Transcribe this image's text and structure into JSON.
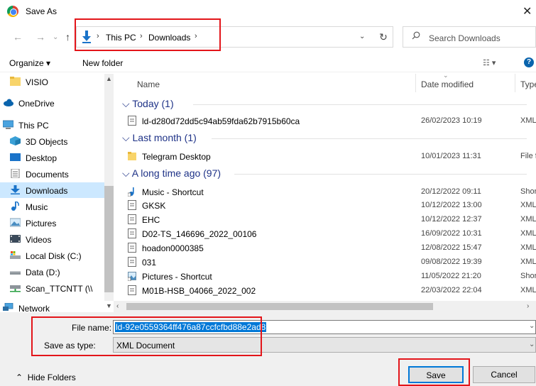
{
  "window": {
    "title": "Save As",
    "close": "✕"
  },
  "address": {
    "crumbs": [
      "This PC",
      "Downloads"
    ],
    "separator": "›",
    "search_placeholder": "Search Downloads"
  },
  "toolbar": {
    "organize": "Organize ▾",
    "new_folder": "New folder",
    "help": "?"
  },
  "nav": {
    "items": [
      {
        "label": "VISIO",
        "icon": "folder-icon"
      },
      {
        "label": "OneDrive",
        "icon": "cloud-icon"
      },
      {
        "label": "This PC",
        "icon": "computer-icon"
      },
      {
        "label": "3D Objects",
        "icon": "cube-icon"
      },
      {
        "label": "Desktop",
        "icon": "desktop-icon"
      },
      {
        "label": "Documents",
        "icon": "documents-icon"
      },
      {
        "label": "Downloads",
        "icon": "download-icon",
        "selected": true
      },
      {
        "label": "Music",
        "icon": "music-icon"
      },
      {
        "label": "Pictures",
        "icon": "pictures-icon"
      },
      {
        "label": "Videos",
        "icon": "videos-icon"
      },
      {
        "label": "Local Disk (C:)",
        "icon": "disk-icon"
      },
      {
        "label": "Data (D:)",
        "icon": "drive-icon"
      },
      {
        "label": "Scan_TTCNTT (\\\\",
        "icon": "network-drive-icon"
      },
      {
        "label": "Network",
        "icon": "network-icon"
      }
    ]
  },
  "columns": {
    "name": "Name",
    "date": "Date modified",
    "type": "Type"
  },
  "groups": [
    {
      "header": "Today (1)",
      "rows": [
        {
          "name": "ld-d280d72dd5c94ab59fda62b7915b60ca",
          "date": "26/02/2023 10:19",
          "type": "XML",
          "icon": "file-icon"
        }
      ]
    },
    {
      "header": "Last month (1)",
      "rows": [
        {
          "name": "Telegram Desktop",
          "date": "10/01/2023 11:31",
          "type": "File f",
          "icon": "folder-icon"
        }
      ]
    },
    {
      "header": "A long time ago (97)",
      "rows": [
        {
          "name": "Music - Shortcut",
          "date": "20/12/2022 09:11",
          "type": "Shor",
          "icon": "music-shortcut-icon"
        },
        {
          "name": "GKSK",
          "date": "10/12/2022 13:00",
          "type": "XML",
          "icon": "file-icon"
        },
        {
          "name": "EHC",
          "date": "10/12/2022 12:37",
          "type": "XML",
          "icon": "file-icon"
        },
        {
          "name": "D02-TS_146696_2022_00106",
          "date": "16/09/2022 10:31",
          "type": "XML",
          "icon": "file-icon"
        },
        {
          "name": "hoadon0000385",
          "date": "12/08/2022 15:47",
          "type": "XML",
          "icon": "file-icon"
        },
        {
          "name": "031",
          "date": "09/08/2022 19:39",
          "type": "XML",
          "icon": "file-icon"
        },
        {
          "name": "Pictures - Shortcut",
          "date": "11/05/2022 21:20",
          "type": "Shor",
          "icon": "pictures-shortcut-icon"
        },
        {
          "name": "M01B-HSB_04066_2022_002",
          "date": "22/03/2022 22:04",
          "type": "XML",
          "icon": "file-icon"
        }
      ]
    }
  ],
  "form": {
    "file_name_label": "File name:",
    "file_name_value": "ld-92e0559364ff476a87ccfcfbd88e2ad8",
    "save_type_label": "Save as type:",
    "save_type_value": "XML Document",
    "save": "Save",
    "cancel": "Cancel",
    "hide_folders": "Hide Folders"
  },
  "colors": {
    "accent": "#0078d7",
    "highlight": "#e3151a",
    "group_header": "#1e3287",
    "selected_bg": "#cce8ff"
  }
}
